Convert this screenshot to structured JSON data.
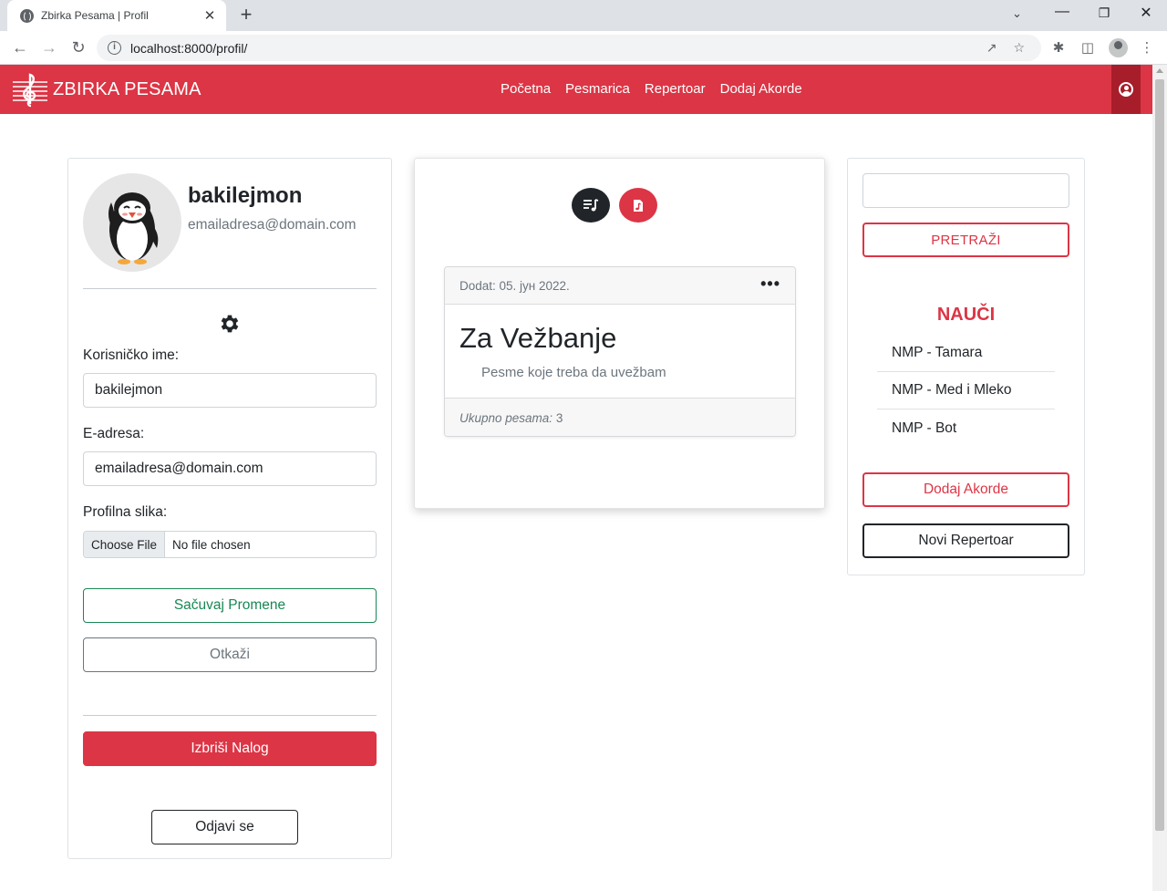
{
  "browser": {
    "tab_title": "Zbirka Pesama | Profil",
    "tab_close": "✕",
    "new_tab": "+",
    "url": "localhost:8000/profil/"
  },
  "navbar": {
    "brand": "ZBIRKA PESAMA",
    "links": [
      "Početna",
      "Pesmarica",
      "Repertoar",
      "Dodaj Akorde"
    ],
    "accent_color": "#dc3545"
  },
  "profile": {
    "username": "bakilejmon",
    "email": "emailadresa@domain.com",
    "form": {
      "username_label": "Korisničko ime:",
      "username_value": "bakilejmon",
      "email_label": "E-adresa:",
      "email_value": "emailadresa@domain.com",
      "picture_label": "Profilna slika:",
      "choose_file": "Choose File",
      "no_file": "No file chosen"
    },
    "save_button": "Sačuvaj Promene",
    "cancel_button": "Otkaži",
    "delete_button": "Izbriši Nalog",
    "logout_button": "Odjavi se"
  },
  "repertoire": {
    "date": "Dodat: 05. јун 2022.",
    "menu_dots": "•••",
    "title": "Za Vežbanje",
    "description": "Pesme koje treba da uvežbam",
    "count_label": "Ukupno pesama:",
    "count_value": "3"
  },
  "sidebar": {
    "search_button": "PRETRAŽI",
    "learn_title": "NAUČI",
    "learn_items": [
      "NMP - Tamara",
      "NMP - Med i Mleko",
      "NMP - Bot"
    ],
    "add_chords_button": "Dodaj Akorde",
    "new_repertoire_button": "Novi Repertoar"
  }
}
